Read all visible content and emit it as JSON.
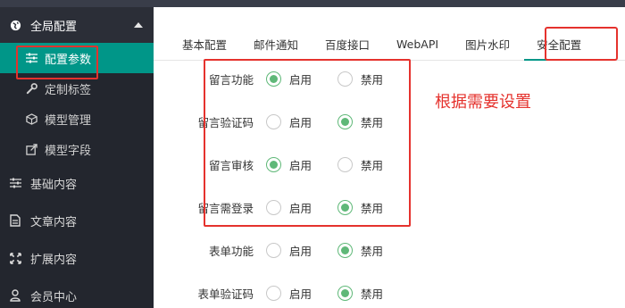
{
  "sidebar": {
    "header": {
      "label": "全局配置",
      "icon": "globe-icon"
    },
    "sub_items": [
      {
        "label": "配置参数",
        "icon": "sliders-icon",
        "active": true
      },
      {
        "label": "定制标签",
        "icon": "wrench-icon"
      },
      {
        "label": "模型管理",
        "icon": "cube-icon"
      },
      {
        "label": "模型字段",
        "icon": "external-link-icon"
      }
    ],
    "groups": [
      {
        "label": "基础内容",
        "icon": "sliders-icon"
      },
      {
        "label": "文章内容",
        "icon": "document-icon"
      },
      {
        "label": "扩展内容",
        "icon": "expand-icon"
      },
      {
        "label": "会员中心",
        "icon": "user-icon"
      }
    ]
  },
  "tabs": [
    "基本配置",
    "邮件通知",
    "百度接口",
    "WebAPI",
    "图片水印",
    "安全配置"
  ],
  "active_tab": "安全配置",
  "annotation": "根据需要设置",
  "options": {
    "enable": "启用",
    "disable": "禁用"
  },
  "settings": [
    {
      "label": "留言功能",
      "value": "启用"
    },
    {
      "label": "留言验证码",
      "value": "禁用"
    },
    {
      "label": "留言审核",
      "value": "启用"
    },
    {
      "label": "留言需登录",
      "value": "禁用"
    },
    {
      "label": "表单功能",
      "value": "禁用"
    },
    {
      "label": "表单验证码",
      "value": "禁用"
    }
  ],
  "colors": {
    "accent": "#009688",
    "radio_checked": "#5fb878",
    "highlight": "#e5322d",
    "sidebar_bg": "#23262e"
  }
}
